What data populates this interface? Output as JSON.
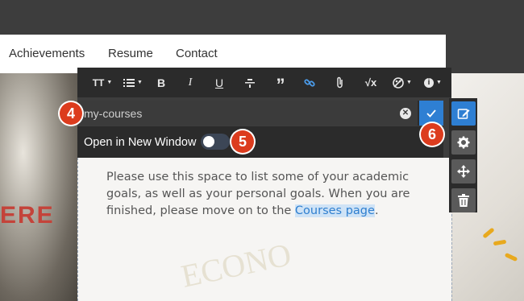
{
  "nav": {
    "links": [
      "Achievements",
      "Resume",
      "Contact"
    ]
  },
  "background": {
    "left_text": "ERE",
    "watermark": "ECONO"
  },
  "toolbar": {
    "text_size_label": "TT",
    "bold_label": "B",
    "italic_label": "I",
    "underline_label": "U",
    "quote_label": "”",
    "math_label": "√x"
  },
  "link_editor": {
    "url_value": "my-courses",
    "open_new_window_label": "Open in New Window",
    "open_new_window_enabled": false
  },
  "content": {
    "text_before": "Please use this space to list some of your academic goals, as well as your personal goals.  When you are finished, please move on to the ",
    "link_text": "Courses page",
    "text_after": "."
  },
  "callouts": [
    "4",
    "5",
    "6"
  ],
  "colors": {
    "accent": "#2e7fd3",
    "callout": "#dc3c1e",
    "toolbar_bg": "#2b2b2b",
    "link_highlight": "#cfe3f6"
  }
}
